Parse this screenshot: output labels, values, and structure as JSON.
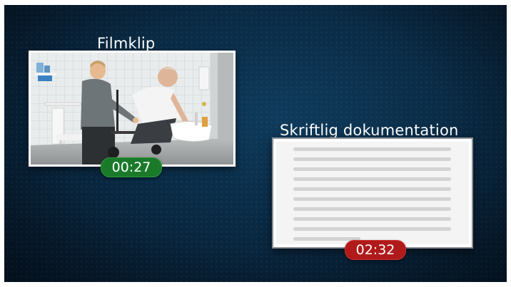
{
  "video": {
    "title": "Filmklip",
    "timer": "00:27",
    "timer_color": "#1a7a2a"
  },
  "documentation": {
    "title": "Skriftlig dokumentation",
    "timer": "02:32",
    "timer_color": "#b01a1a",
    "icon": "document-lines-icon"
  },
  "background_color": "#0a2c47"
}
